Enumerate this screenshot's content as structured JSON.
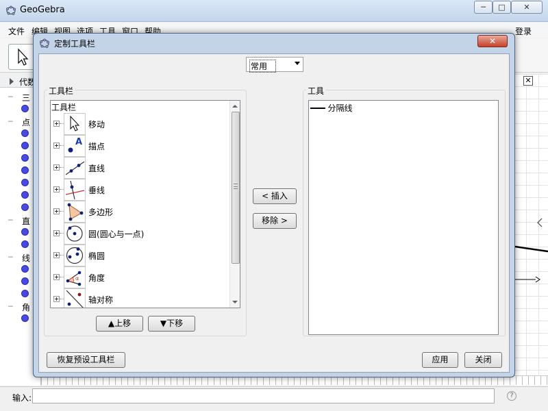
{
  "main_window": {
    "title": "GeoGebra",
    "controls": {
      "minimize": "─",
      "maximize": "□",
      "close": "✕"
    },
    "menu": [
      "文件",
      "编辑",
      "视图",
      "选项",
      "工具",
      "窗口",
      "帮助"
    ],
    "login": "登录",
    "algebra_header": "代数",
    "algebra_categories": [
      "三",
      "点",
      "直",
      "线",
      "角"
    ],
    "input_label": "输入:",
    "input_value": "",
    "help": "?"
  },
  "dialog": {
    "title": "定制工具栏",
    "close": "✕",
    "preset_select": {
      "value": "常用"
    },
    "toolbar_group_label": "工具栏",
    "tools_group_label": "工具",
    "toolbar_tree": {
      "root": "工具栏",
      "items": [
        {
          "label": "移动",
          "icon": "move-arrow-icon"
        },
        {
          "label": "描点",
          "icon": "point-icon"
        },
        {
          "label": "直线",
          "icon": "line-icon"
        },
        {
          "label": "垂线",
          "icon": "perpendicular-line-icon"
        },
        {
          "label": "多边形",
          "icon": "polygon-icon"
        },
        {
          "label": "圆(圆心与一点)",
          "icon": "circle-center-point-icon"
        },
        {
          "label": "椭圆",
          "icon": "ellipse-icon"
        },
        {
          "label": "角度",
          "icon": "angle-icon"
        },
        {
          "label": "轴对称",
          "icon": "reflect-line-icon"
        }
      ]
    },
    "tools_list": {
      "items": [
        "━━━ 分隔线"
      ]
    },
    "buttons": {
      "move_up": "▲上移",
      "move_down": "▼下移",
      "insert": "< 插入",
      "remove": "移除 >",
      "restore_default": "恢复预设工具栏",
      "apply": "应用",
      "close": "关闭"
    }
  }
}
